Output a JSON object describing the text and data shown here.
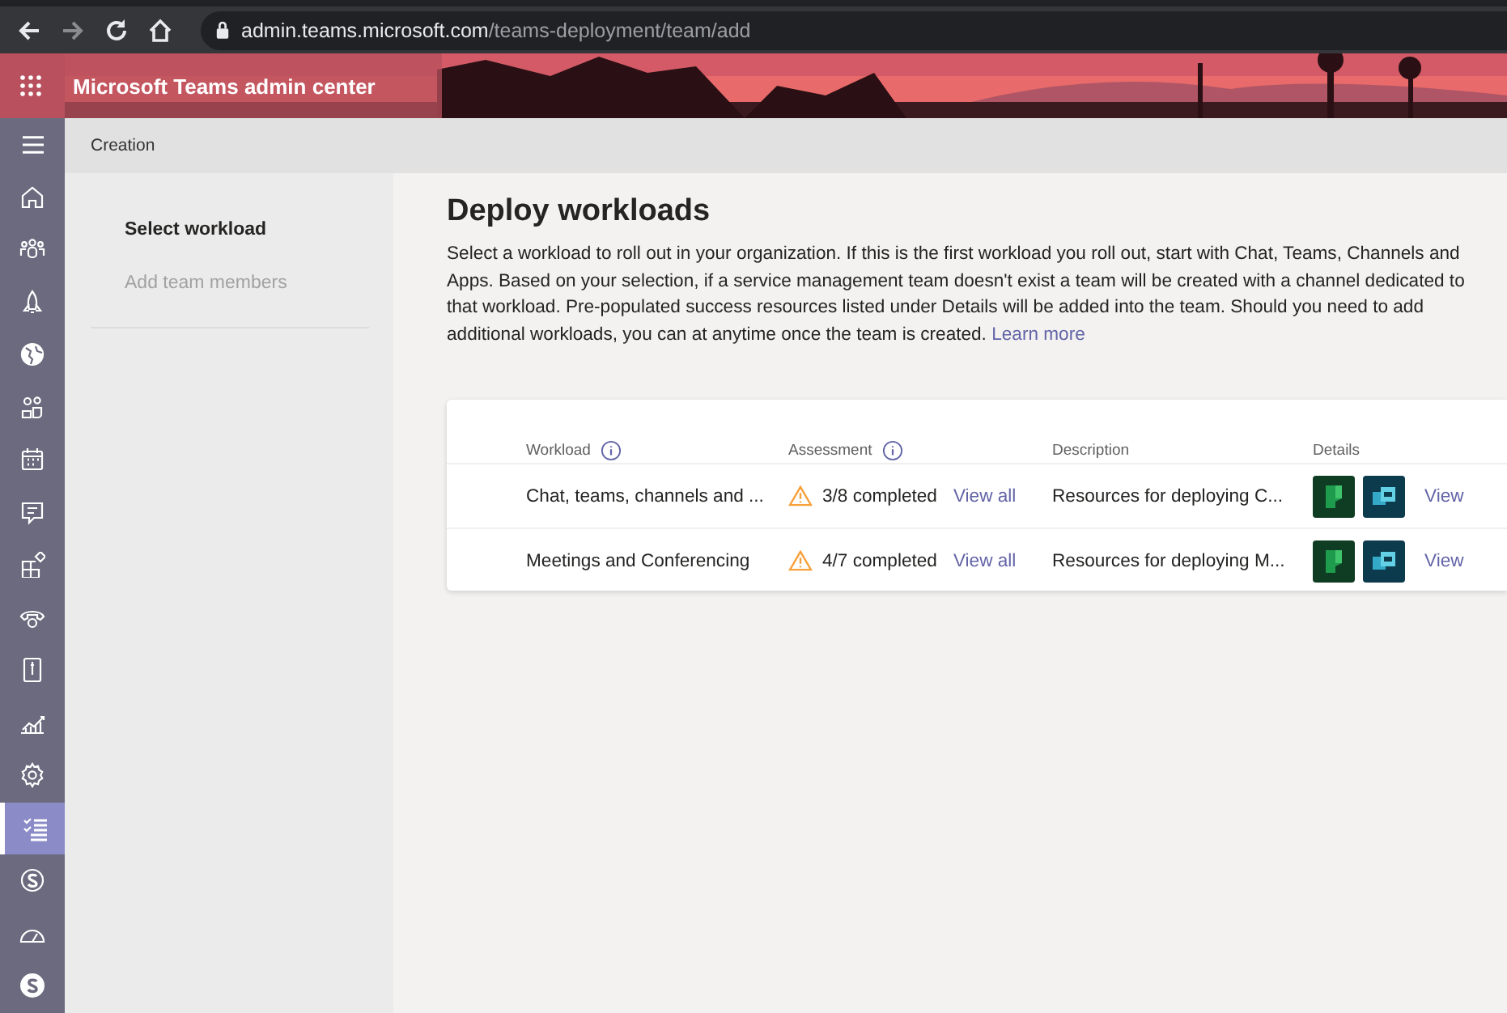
{
  "browser": {
    "url_host": "admin.teams.microsoft.com",
    "url_path": "/teams-deployment/team/add"
  },
  "header": {
    "title": "Microsoft Teams admin center"
  },
  "rail": {
    "items": [
      {
        "kind": "home",
        "selected": false
      },
      {
        "kind": "teams",
        "selected": false
      },
      {
        "kind": "rocket",
        "selected": false
      },
      {
        "kind": "globe",
        "selected": false
      },
      {
        "kind": "users",
        "selected": false
      },
      {
        "kind": "calendar",
        "selected": false
      },
      {
        "kind": "message",
        "selected": false
      },
      {
        "kind": "apps",
        "selected": false
      },
      {
        "kind": "phone",
        "selected": false
      },
      {
        "kind": "policy",
        "selected": false
      },
      {
        "kind": "analytics",
        "selected": false
      },
      {
        "kind": "settings",
        "selected": false
      },
      {
        "kind": "planning",
        "selected": true
      },
      {
        "kind": "skype",
        "selected": false
      },
      {
        "kind": "gauge",
        "selected": false
      },
      {
        "kind": "s-circle",
        "selected": false
      }
    ]
  },
  "breadcrumb": "Creation",
  "steps": [
    {
      "label": "Select workload",
      "selected": true
    },
    {
      "label": "Add team members",
      "selected": false
    }
  ],
  "page": {
    "title": "Deploy workloads",
    "description": "Select a workload to roll out in your organization. If this is the first workload you roll out, start with Chat, Teams, Channels and Apps. Based on your selection, if a service management team doesn't exist a team will be created with a channel dedicated to that workload. Pre-populated success resources listed under Details will be added into the team. Should you need to add additional workloads, you can at anytime once the team is created.",
    "link": "Learn more"
  },
  "table": {
    "columns": [
      {
        "label": "Workload",
        "info": true
      },
      {
        "label": "Assessment",
        "info": true
      },
      {
        "label": "Description",
        "info": false
      },
      {
        "label": "Details",
        "info": false
      }
    ],
    "rows": [
      {
        "workload": "Chat, teams, channels and ...",
        "assessment": "3/8 completed",
        "view_all": "View all",
        "description": "Resources for deploying C...",
        "view": "View"
      },
      {
        "workload": "Meetings and Conferencing",
        "assessment": "4/7 completed",
        "view_all": "View all",
        "description": "Resources for deploying M...",
        "view": "View"
      }
    ]
  }
}
